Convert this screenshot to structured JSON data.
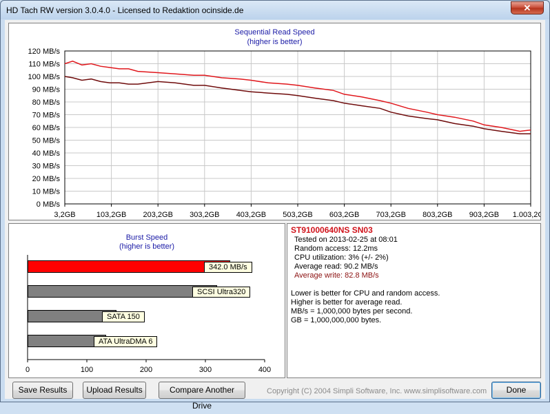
{
  "window": {
    "title": "HD Tach RW version 3.0.4.0 - Licensed to Redaktion ocinside.de",
    "close_glyph": "✕"
  },
  "sequential": {
    "title": "Sequential Read Speed",
    "subtitle": "(higher is better)",
    "y_ticks": [
      "0 MB/s",
      "10 MB/s",
      "20 MB/s",
      "30 MB/s",
      "40 MB/s",
      "50 MB/s",
      "60 MB/s",
      "70 MB/s",
      "80 MB/s",
      "90 MB/s",
      "100 MB/s",
      "110 MB/s",
      "120 MB/s"
    ],
    "x_ticks": [
      "3,2GB",
      "103,2GB",
      "203,2GB",
      "303,2GB",
      "403,2GB",
      "503,2GB",
      "603,2GB",
      "703,2GB",
      "803,2GB",
      "903,2GB",
      "1.003,2GB"
    ],
    "read_color": "#e0161b",
    "write_color": "#6e0a0a"
  },
  "chart_data": {
    "type": "line",
    "title": "Sequential Read Speed",
    "subtitle": "(higher is better)",
    "xlabel": "",
    "ylabel": "",
    "ylim": [
      0,
      120
    ],
    "xlim": [
      3.2,
      1003.2
    ],
    "grid": true,
    "series": [
      {
        "color": "#e0161b",
        "x": [
          3.2,
          20,
          40,
          60,
          80,
          100,
          120,
          140,
          160,
          203.2,
          240,
          280,
          303.2,
          340,
          380,
          403.2,
          440,
          480,
          503.2,
          540,
          580,
          603.2,
          640,
          680,
          703.2,
          740,
          780,
          803.2,
          840,
          880,
          903.2,
          940,
          980,
          1003.2
        ],
        "y": [
          110,
          112,
          109,
          110,
          108,
          107,
          106,
          106,
          104,
          103,
          102,
          101,
          101,
          99,
          98,
          97,
          95,
          94,
          93,
          91,
          89,
          86,
          84,
          81,
          79,
          75,
          72,
          70,
          68,
          65,
          62,
          60,
          57,
          58
        ]
      },
      {
        "color": "#6e0a0a",
        "x": [
          3.2,
          20,
          40,
          60,
          80,
          100,
          120,
          140,
          160,
          203.2,
          240,
          280,
          303.2,
          340,
          380,
          403.2,
          440,
          480,
          503.2,
          540,
          580,
          603.2,
          640,
          680,
          703.2,
          740,
          780,
          803.2,
          840,
          880,
          903.2,
          940,
          980,
          1003.2
        ],
        "y": [
          100,
          99,
          97,
          98,
          96,
          95,
          95,
          94,
          94,
          96,
          95,
          93,
          93,
          91,
          89,
          88,
          87,
          86,
          85,
          83,
          81,
          79,
          77,
          75,
          72,
          69,
          67,
          66,
          63,
          61,
          59,
          57,
          55,
          55
        ]
      }
    ]
  },
  "burst": {
    "title": "Burst Speed",
    "subtitle": "(higher is better)",
    "bars": [
      {
        "label": "342.0 MB/s",
        "value": 342,
        "color": "#ff0000"
      },
      {
        "label": "SCSI Ultra320",
        "value": 320,
        "color": "#808080"
      },
      {
        "label": "SATA 150",
        "value": 150,
        "color": "#808080"
      },
      {
        "label": "ATA UltraDMA 6",
        "value": 133,
        "color": "#808080"
      }
    ],
    "x_ticks": [
      "0",
      "100",
      "200",
      "300",
      "400"
    ],
    "xmax": 400
  },
  "info": {
    "drive": "ST91000640NS  SN03",
    "tested": "Tested on 2013-02-25 at 08:01",
    "random_access": "Random access: 12.2ms",
    "cpu": "CPU utilization: 3% (+/- 2%)",
    "avg_read": "Average read: 90.2 MB/s",
    "avg_write": "Average write: 82.8 MB/s",
    "note1": "Lower is better for CPU and random access.",
    "note2": "Higher is better for average read.",
    "note3": "MB/s = 1,000,000 bytes per second.",
    "note4": "GB = 1,000,000,000 bytes."
  },
  "buttons": {
    "save": "Save Results",
    "upload": "Upload Results",
    "compare": "Compare Another Drive",
    "done": "Done"
  },
  "copyright": "Copyright (C) 2004 Simpli Software, Inc. www.simplisoftware.com"
}
